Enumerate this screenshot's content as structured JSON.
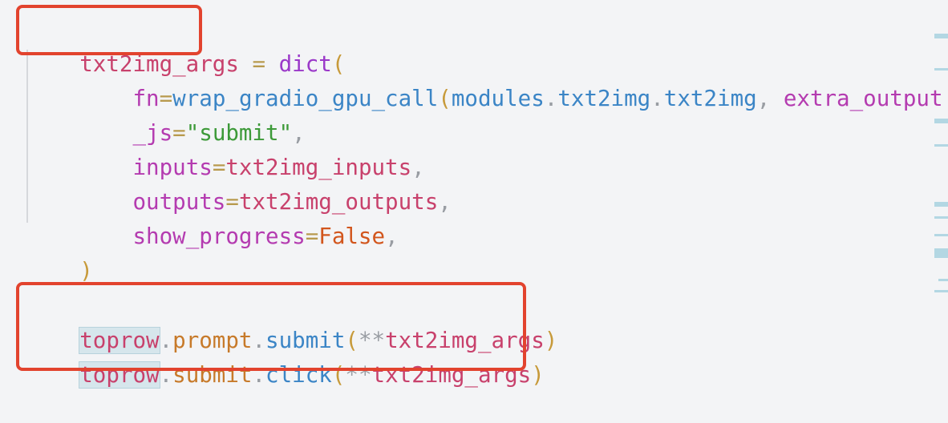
{
  "code": {
    "line1": {
      "var": "txt2img_args",
      "eq": " = ",
      "fn": "dict",
      "paren": "("
    },
    "line2": {
      "indent": "    ",
      "kw": "fn",
      "eq": "=",
      "call": "wrap_gradio_gpu_call",
      "paren": "(",
      "mod1": "modules",
      "dot1": ".",
      "mod2": "txt2img",
      "dot2": ".",
      "mod3": "txt2img",
      "comma": ", ",
      "kwarg": "extra_output"
    },
    "line3": {
      "indent": "    ",
      "kw": "_js",
      "eq": "=",
      "str": "\"submit\"",
      "comma": ","
    },
    "line4": {
      "indent": "    ",
      "kw": "inputs",
      "eq": "=",
      "val": "txt2img_inputs",
      "comma": ","
    },
    "line5": {
      "indent": "    ",
      "kw": "outputs",
      "eq": "=",
      "val": "txt2img_outputs",
      "comma": ","
    },
    "line6": {
      "indent": "    ",
      "kw": "show_progress",
      "eq": "=",
      "const": "False",
      "comma": ","
    },
    "line7": {
      "paren": ")"
    },
    "line9": {
      "obj": "toprow",
      "dot1": ".",
      "attr": "prompt",
      "dot2": ".",
      "fn": "submit",
      "paren_open": "(",
      "op": "**",
      "arg": "txt2img_args",
      "paren_close": ")"
    },
    "line10": {
      "obj": "toprow",
      "dot1": ".",
      "fn": "submit",
      "dot2": ".",
      "fn2": "click",
      "paren_open": "(",
      "op": "**",
      "arg": "txt2img_args",
      "paren_close": ")"
    }
  },
  "colors": {
    "highlight_box": "#e2432e",
    "background": "#f3f4f6"
  }
}
